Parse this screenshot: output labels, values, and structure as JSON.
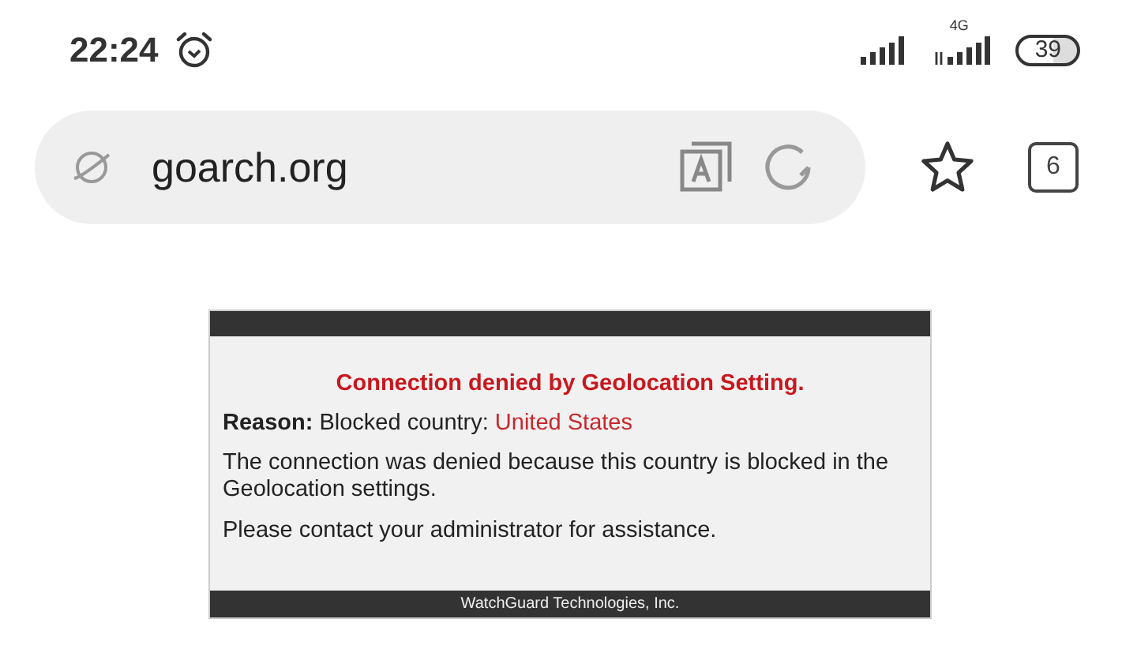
{
  "status_bar": {
    "time": "22:24",
    "network_label": "4G",
    "battery": "39"
  },
  "browser": {
    "url": "goarch.org",
    "tab_count": "6"
  },
  "page": {
    "title": "Connection denied by Geolocation Setting.",
    "reason_label": "Reason:",
    "reason_text": "Blocked country:",
    "country": "United States",
    "message": "The connection was denied because this country is blocked in the Geolocation settings.",
    "contact": "Please contact your administrator for assistance.",
    "footer": "WatchGuard Technologies, Inc."
  }
}
